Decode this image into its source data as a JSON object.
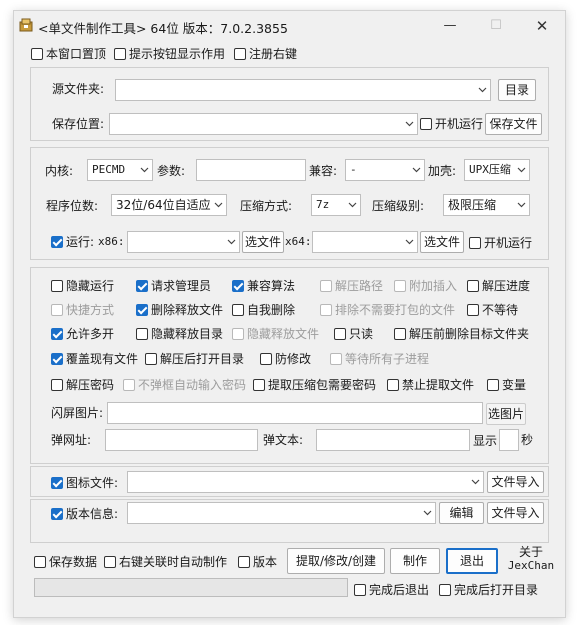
{
  "window": {
    "title": "<单文件制作工具> 64位 版本：7.0.2.3855",
    "min_glyph": "—",
    "max_glyph": "☐",
    "close_glyph": "✕"
  },
  "top_options": [
    {
      "label": "本窗口置顶",
      "checked": false
    },
    {
      "label": "提示按钮显示作用",
      "checked": false
    },
    {
      "label": "注册右键",
      "checked": false
    }
  ],
  "source": {
    "source_label": "源文件夹:",
    "source_value": "",
    "dir_button": "目录",
    "save_label": "保存位置:",
    "save_value": "",
    "autorun_label": "开机运行",
    "save_file_button": "保存文件"
  },
  "settings": {
    "kernel_label": "内核:",
    "kernel_value": "PECMD",
    "params_label": "参数:",
    "params_value": "",
    "compat_label": "兼容:",
    "compat_value": "-",
    "shell_label": "加壳:",
    "shell_value": "UPX压缩",
    "bits_label": "程序位数:",
    "bits_value": "32位/64位自适应",
    "compress_label": "压缩方式:",
    "compress_value": "7z",
    "level_label": "压缩级别:",
    "level_value": "极限压缩",
    "run_label": "运行:",
    "run_checked": true,
    "x86_label": "x86:",
    "x86_value": "",
    "choose_file": "选文件",
    "x64_label": "x64:",
    "x64_value": "",
    "choose_file2": "选文件",
    "autorun_label": "开机运行"
  },
  "options": {
    "row1": [
      {
        "label": "隐藏运行",
        "checked": false,
        "disabled": false
      },
      {
        "label": "请求管理员",
        "checked": true,
        "disabled": false
      },
      {
        "label": "兼容算法",
        "checked": true,
        "disabled": false
      },
      {
        "label": "解压路径",
        "checked": false,
        "disabled": true
      },
      {
        "label": "附加插入",
        "checked": false,
        "disabled": true
      },
      {
        "label": "解压进度",
        "checked": false,
        "disabled": false
      }
    ],
    "row2": [
      {
        "label": "快捷方式",
        "checked": false,
        "disabled": true
      },
      {
        "label": "删除释放文件",
        "checked": true,
        "disabled": false
      },
      {
        "label": "自我删除",
        "checked": false,
        "disabled": false
      },
      {
        "label": "排除不需要打包的文件",
        "checked": false,
        "disabled": true
      },
      {
        "label": "不等待",
        "checked": false,
        "disabled": false
      }
    ],
    "row3": [
      {
        "label": "允许多开",
        "checked": true,
        "disabled": false
      },
      {
        "label": "隐藏释放目录",
        "checked": false,
        "disabled": false
      },
      {
        "label": "隐藏释放文件",
        "checked": false,
        "disabled": true
      },
      {
        "label": "只读",
        "checked": false,
        "disabled": false
      },
      {
        "label": "解压前删除目标文件夹",
        "checked": false,
        "disabled": false
      }
    ],
    "row4": [
      {
        "label": "覆盖现有文件",
        "checked": true,
        "disabled": false
      },
      {
        "label": "解压后打开目录",
        "checked": false,
        "disabled": false
      },
      {
        "label": "防修改",
        "checked": false,
        "disabled": false
      },
      {
        "label": "等待所有子进程",
        "checked": false,
        "disabled": true
      }
    ],
    "row5": [
      {
        "label": "解压密码",
        "checked": false,
        "disabled": false
      },
      {
        "label": "不弹框自动输入密码",
        "checked": false,
        "disabled": true
      },
      {
        "label": "提取压缩包需要密码",
        "checked": false,
        "disabled": false
      },
      {
        "label": "禁止提取文件",
        "checked": false,
        "disabled": false
      },
      {
        "label": "变量",
        "checked": false,
        "disabled": false
      }
    ],
    "splash_label": "闪屏图片:",
    "splash_value": "",
    "choose_image": "选图片",
    "popup_url_label": "弹网址:",
    "popup_url_value": "",
    "popup_text_label": "弹文本:",
    "popup_text_value": "",
    "show_label": "显示",
    "seconds_value": "",
    "seconds_label": "秒"
  },
  "icon_file": {
    "label": "图标文件:",
    "checked": true,
    "value": "",
    "import_button": "文件导入"
  },
  "version_info": {
    "label": "版本信息:",
    "checked": true,
    "value": "",
    "edit_button": "编辑",
    "import_button": "文件导入"
  },
  "bottom": {
    "save_data": "保存数据",
    "right_click_auto": "右键关联时自动制作",
    "version_cb": "版本",
    "extract_button": "提取/修改/创建",
    "make_button": "制作",
    "exit_button": "退出",
    "about_line1": "关于",
    "about_line2": "JexChan",
    "progress": 0,
    "exit_after": "完成后退出",
    "open_after": "完成后打开目录"
  },
  "colors": {
    "accent": "#1a6fc9",
    "window_bg": "#f0f0f0"
  }
}
